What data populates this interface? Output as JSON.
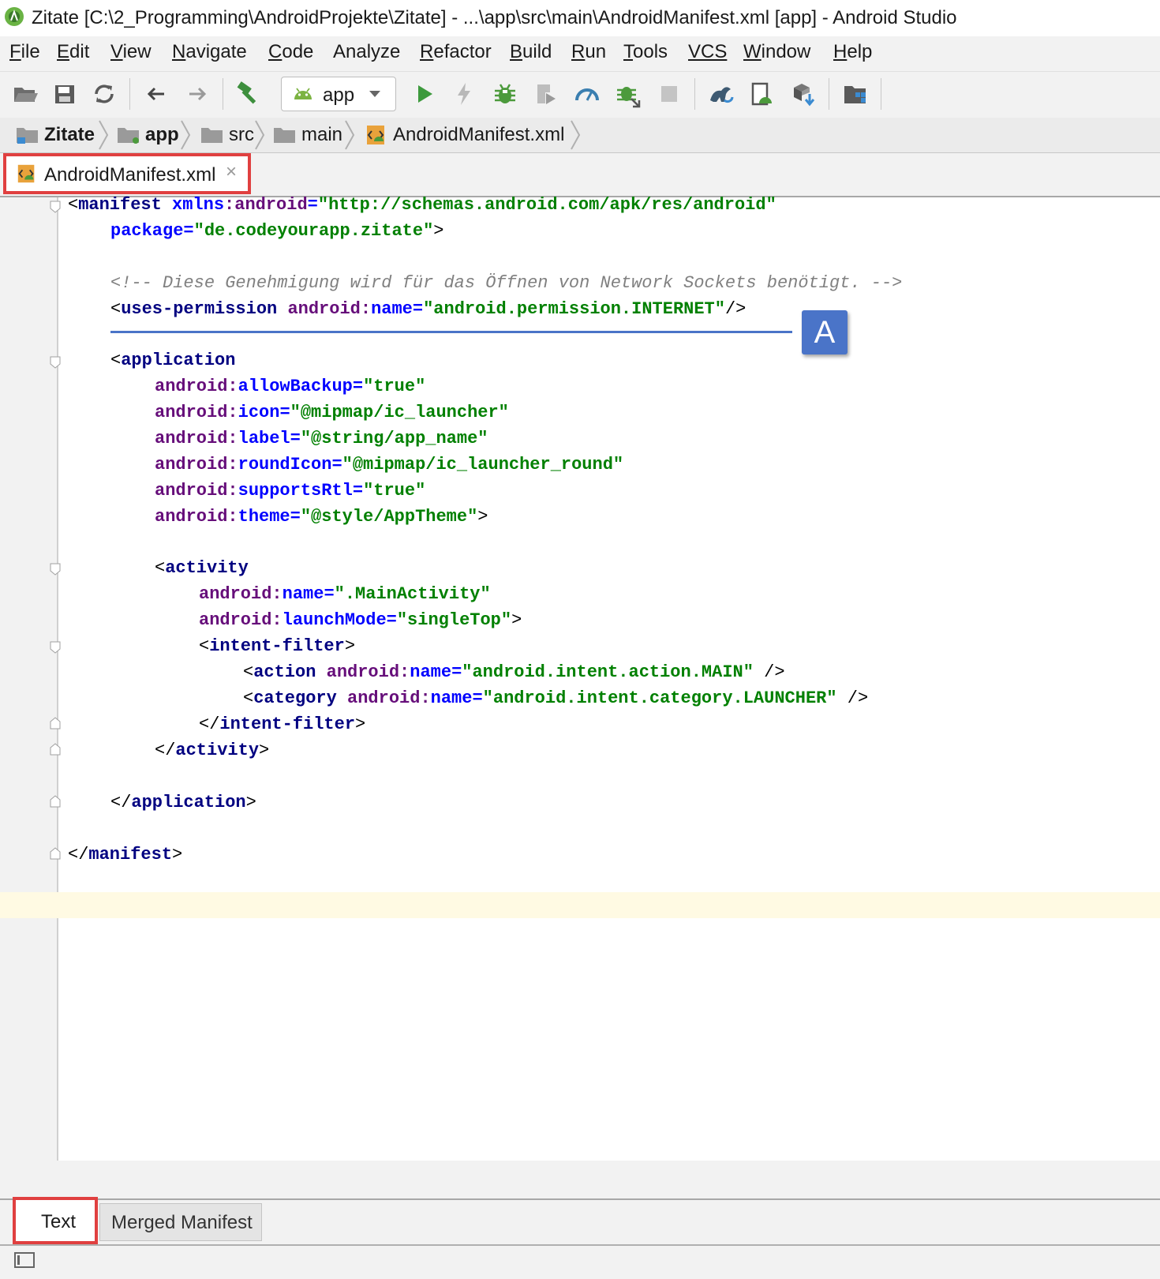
{
  "window": {
    "title": "Zitate [C:\\2_Programming\\AndroidProjekte\\Zitate] - ...\\app\\src\\main\\AndroidManifest.xml [app] - Android Studio"
  },
  "menu": [
    {
      "mnemonic": "F",
      "rest": "ile"
    },
    {
      "mnemonic": "E",
      "rest": "dit"
    },
    {
      "mnemonic": "V",
      "rest": "iew"
    },
    {
      "mnemonic": "N",
      "rest": "avigate"
    },
    {
      "mnemonic": "C",
      "rest": "ode"
    },
    {
      "mnemonic": "",
      "rest": "Analyze"
    },
    {
      "mnemonic": "R",
      "rest": "efactor"
    },
    {
      "mnemonic": "B",
      "rest": "uild"
    },
    {
      "mnemonic": "R",
      "rest": "un",
      "pre": ""
    },
    {
      "mnemonic": "T",
      "rest": "ools"
    },
    {
      "mnemonic": "",
      "rest": "VCS"
    },
    {
      "mnemonic": "W",
      "rest": "indow"
    },
    {
      "mnemonic": "H",
      "rest": "elp"
    }
  ],
  "toolbar": {
    "run_config": "app",
    "icons": [
      "open-folder-icon",
      "save-icon",
      "sync-icon",
      "back-arrow-icon",
      "forward-arrow-icon",
      "make-project-icon",
      "run-icon",
      "apply-changes-icon",
      "debug-icon",
      "coverage-icon",
      "profile-icon",
      "attach-debugger-icon",
      "stop-icon",
      "gradle-sync-icon",
      "avd-manager-icon",
      "sdk-manager-icon",
      "project-structure-icon"
    ]
  },
  "breadcrumb": [
    "Zitate",
    "app",
    "src",
    "main",
    "AndroidManifest.xml"
  ],
  "editor_tab": {
    "label": "AndroidManifest.xml",
    "close": "×"
  },
  "code": {
    "l1": {
      "p1": "<",
      "tag": "manifest",
      "sp": " ",
      "ns": "xmlns",
      "colon": ":",
      "attr": "android",
      "eq": "=",
      "val": "\"http://schemas.android.com/apk/res/android\""
    },
    "l2": {
      "ak": "package",
      "eq": "=",
      "val": "\"de.codeyourapp.zitate\"",
      "end": ">"
    },
    "l3": {
      "comment": "<!-- Diese Genehmigung wird für das Öffnen von Network Sockets benötigt. -->"
    },
    "l4": {
      "p1": "<",
      "tag": "uses-permission",
      "an": "android",
      "colon": ":",
      "ak": "name",
      "eq": "=",
      "val": "\"android.permission.INTERNET\"",
      "end": "/>"
    },
    "l5": {
      "p1": "<",
      "tag": "application"
    },
    "l6": {
      "an": "android",
      "ak": "allowBackup",
      "val": "\"true\""
    },
    "l7": {
      "an": "android",
      "ak": "icon",
      "val": "\"@mipmap/ic_launcher\""
    },
    "l8": {
      "an": "android",
      "ak": "label",
      "val": "\"@string/app_name\""
    },
    "l9": {
      "an": "android",
      "ak": "roundIcon",
      "val": "\"@mipmap/ic_launcher_round\""
    },
    "l10": {
      "an": "android",
      "ak": "supportsRtl",
      "val": "\"true\""
    },
    "l11": {
      "an": "android",
      "ak": "theme",
      "val": "\"@style/AppTheme\"",
      "end": ">"
    },
    "l12": {
      "p1": "<",
      "tag": "activity"
    },
    "l13": {
      "an": "android",
      "ak": "name",
      "val": "\".MainActivity\""
    },
    "l14": {
      "an": "android",
      "ak": "launchMode",
      "val": "\"singleTop\"",
      "end": ">"
    },
    "l15": {
      "p1": "<",
      "tag": "intent-filter",
      "end": ">"
    },
    "l16": {
      "p1": "<",
      "tag": "action",
      "an": "android",
      "ak": "name",
      "val": "\"android.intent.action.MAIN\"",
      "end": " />"
    },
    "l17": {
      "p1": "<",
      "tag": "category",
      "an": "android",
      "ak": "name",
      "val": "\"android.intent.category.LAUNCHER\"",
      "end": " />"
    },
    "l18": {
      "p1": "</",
      "tag": "intent-filter",
      "end": ">"
    },
    "l19": {
      "p1": "</",
      "tag": "activity",
      "end": ">"
    },
    "l20": {
      "p1": "</",
      "tag": "application",
      "end": ">"
    },
    "l21": {
      "p1": "</",
      "tag": "manifest",
      "end": ">"
    }
  },
  "callout": {
    "label": "A",
    "color": "#4a74c8"
  },
  "bottom_tabs": {
    "text": "Text",
    "merged": "Merged Manifest"
  },
  "colors": {
    "highlight_border": "#e04040",
    "tag": "#000080",
    "attr_ns": "#660e7a",
    "attr_key": "#0000ff",
    "attr_val": "#008000",
    "comment": "#808080"
  }
}
